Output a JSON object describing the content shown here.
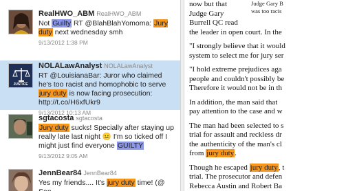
{
  "tweets": [
    {
      "name": "RealHWO_ABM",
      "handle": "RealHWO_ABM",
      "text_segments": [
        {
          "t": "Not ",
          "h": ""
        },
        {
          "t": "Guilty",
          "h": "blue"
        },
        {
          "t": " RT @BlahBlahYomoma: ",
          "h": ""
        },
        {
          "t": "Jury duty",
          "h": "orange"
        },
        {
          "t": " next wednesday smh",
          "h": ""
        }
      ],
      "time": "9/13/2012 1:38 PM"
    },
    {
      "name": "NOLALawAnalyst",
      "handle": "NOLALawAnalyst",
      "avatar_label": "JUSTICE",
      "text_segments": [
        {
          "t": "RT @LouisianaBar: Juror who claimed he's too racist and homophobic to serve ",
          "h": ""
        },
        {
          "t": "jury duty",
          "h": "orange"
        },
        {
          "t": " is now facing prosecution: http://t.co/H6xfUkr9",
          "h": ""
        }
      ],
      "time": "9/13/2012 10:13 AM"
    },
    {
      "name": "sgtacosta",
      "handle": "sgtacosta",
      "text_segments": [
        {
          "t": "Jury duty",
          "h": "orange"
        },
        {
          "t": " sucks! Specially after staying up really late last night ",
          "h": ""
        },
        {
          "t": "😐",
          "h": ""
        },
        {
          "t": " I'm so ticked off I might just find everyone ",
          "h": ""
        },
        {
          "t": "GUILTY",
          "h": "blue"
        }
      ],
      "time": "9/13/2012 9:05 AM"
    },
    {
      "name": "JennBear84",
      "handle": "JennBear84",
      "text_segments": [
        {
          "t": "Yes my friends.... It's ",
          "h": ""
        },
        {
          "t": "jury duty",
          "h": "orange"
        },
        {
          "t": " time! (@ San",
          "h": ""
        }
      ],
      "time": ""
    }
  ],
  "article": {
    "sidebox_lines": [
      "Judge Gary B",
      "was too racis"
    ],
    "paragraphs": [
      [
        [
          {
            "t": "now but that",
            "h": ""
          }
        ],
        [
          {
            "t": "Judge Gary",
            "h": ""
          }
        ],
        [
          {
            "t": "Burrell QC read",
            "h": ""
          }
        ],
        [
          {
            "t": "the leader in open court. In the",
            "h": ""
          }
        ]
      ],
      [
        [
          {
            "t": "\"I strongly believe that it would",
            "h": ""
          }
        ],
        [
          {
            "t": "system to select me for jury ser",
            "h": ""
          }
        ]
      ],
      [
        [
          {
            "t": "\"I hold extreme prejudices aga",
            "h": ""
          }
        ],
        [
          {
            "t": "people and couldn't possibly be",
            "h": ""
          }
        ],
        [
          {
            "t": "Therefore it would not be in th",
            "h": ""
          }
        ]
      ],
      [
        [
          {
            "t": "In addition, the man said that",
            "h": ""
          }
        ],
        [
          {
            "t": "pay attention to the case and w",
            "h": ""
          }
        ]
      ],
      [
        [
          {
            "t": "The man had been selected to s",
            "h": ""
          }
        ],
        [
          {
            "t": "trial for assault and reckless dr",
            "h": ""
          }
        ],
        [
          {
            "t": "the authenticity of the man's cl",
            "h": ""
          }
        ],
        [
          {
            "t": "from ",
            "h": ""
          },
          {
            "t": "jury duty",
            "h": "orange"
          },
          {
            "t": ".",
            "h": ""
          }
        ]
      ],
      [
        [
          {
            "t": "Though he escaped ",
            "h": ""
          },
          {
            "t": "jury duty",
            "h": "orange"
          },
          {
            "t": ", t",
            "h": ""
          }
        ],
        [
          {
            "t": "trial. The prosecutor and defen",
            "h": ""
          }
        ],
        [
          {
            "t": "Rebecca Austin and Robert Ba",
            "h": ""
          }
        ]
      ]
    ]
  },
  "colors": {
    "highlight_orange": "#f7961d",
    "highlight_blue": "#8b97e8",
    "selected_row": "#c9dff4"
  },
  "icons": {
    "emoji": "neutral-face-icon"
  }
}
